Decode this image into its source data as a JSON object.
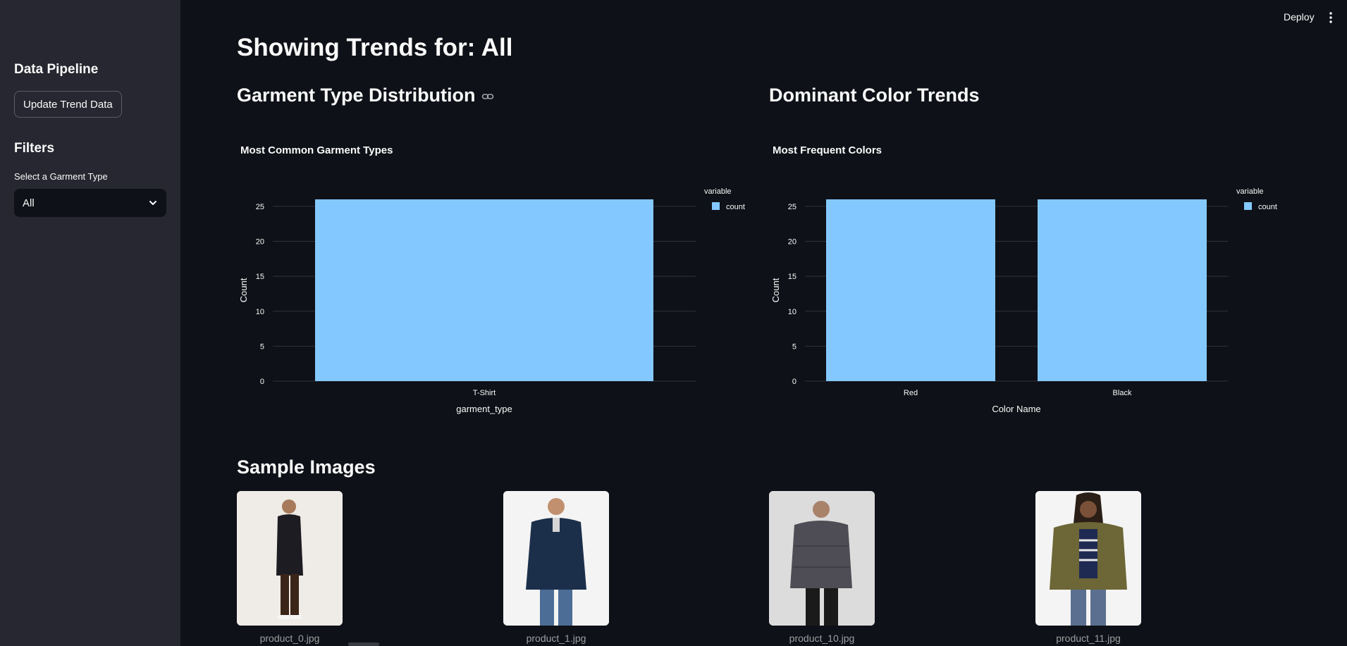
{
  "sidebar": {
    "pipeline_heading": "Data Pipeline",
    "update_button": "Update Trend Data",
    "filters_heading": "Filters",
    "select_label": "Select a Garment Type",
    "select_value": "All"
  },
  "header": {
    "deploy_label": "Deploy"
  },
  "main": {
    "title": "Showing Trends for: All",
    "garment_heading": "Garment Type Distribution",
    "color_heading": "Dominant Color Trends",
    "samples_heading": "Sample Images",
    "images": [
      {
        "caption": "product_0.jpg"
      },
      {
        "caption": "product_1.jpg"
      },
      {
        "caption": "product_10.jpg"
      },
      {
        "caption": "product_11.jpg"
      }
    ]
  },
  "colors": {
    "bar": "#83c9ff",
    "grid": "#31333f",
    "axis_text": "#fafafa"
  },
  "chart_data": [
    {
      "type": "bar",
      "title": "Most Common Garment Types",
      "categories": [
        "T-Shirt"
      ],
      "series": [
        {
          "name": "count",
          "values": [
            26
          ]
        }
      ],
      "xlabel": "garment_type",
      "ylabel": "Count",
      "ylim": [
        0,
        26
      ],
      "yticks": [
        0,
        5,
        10,
        15,
        20,
        25
      ],
      "legend_title": "variable",
      "legend_position": "top-right",
      "grid": true
    },
    {
      "type": "bar",
      "title": "Most Frequent Colors",
      "categories": [
        "Red",
        "Black"
      ],
      "series": [
        {
          "name": "count",
          "values": [
            26,
            26
          ]
        }
      ],
      "xlabel": "Color Name",
      "ylabel": "Count",
      "ylim": [
        0,
        26
      ],
      "yticks": [
        0,
        5,
        10,
        15,
        20,
        25
      ],
      "legend_title": "variable",
      "legend_position": "top-right",
      "grid": true
    }
  ]
}
